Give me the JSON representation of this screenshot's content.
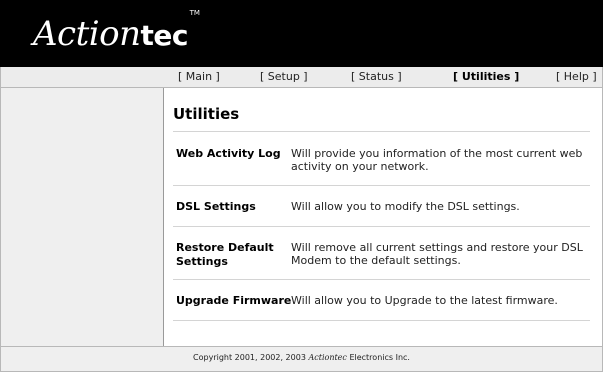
{
  "brand": {
    "logo_script": "Action",
    "logo_bold": "tec",
    "logo_tm": "TM"
  },
  "nav": {
    "main": "[ Main ]",
    "setup": "[ Setup ]",
    "status": "[ Status ]",
    "utilities": "[ Utilities ]",
    "help": "[ Help ]",
    "active": "utilities"
  },
  "page": {
    "title": "Utilities",
    "items": [
      {
        "label": "Web Activity Log",
        "description": "Will provide you information of the most current web activity on your network."
      },
      {
        "label": "DSL Settings",
        "description": "Will allow you to modify the DSL settings."
      },
      {
        "label": "Restore Default Settings",
        "description": "Will remove all current settings and restore your DSL Modem to the default settings."
      },
      {
        "label": "Upgrade Firmware",
        "description": "Will allow you to Upgrade to the latest firmware."
      }
    ]
  },
  "footer": {
    "copyright_prefix": "Copyright 2001, 2002, 2003 ",
    "copyright_brand": "Actiontec",
    "copyright_suffix": " Electronics Inc."
  },
  "colors": {
    "header_bg": "#000000",
    "nav_bg": "#ececec",
    "sidebar_bg": "#efefef"
  }
}
